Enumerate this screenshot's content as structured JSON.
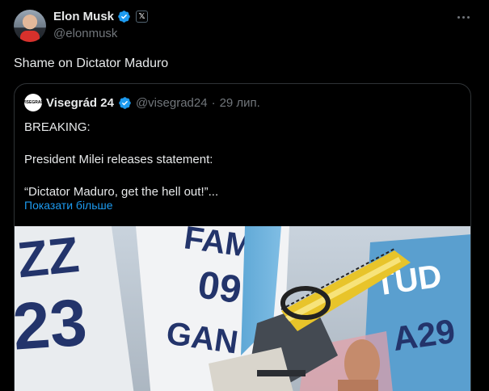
{
  "post": {
    "author_name": "Elon Musk",
    "author_handle": "@elonmusk",
    "x_badge": "𝕏",
    "text": "Shame on Dictator Maduro",
    "more_icon": "more-horizontal-icon"
  },
  "quote": {
    "avatar_text": "VISEGRAD",
    "name": "Visegrád 24",
    "handle": "@visegrad24",
    "separator": "·",
    "date": "29 лип.",
    "lines": [
      "BREAKING:",
      "President Milei releases statement:",
      "“Dictator Maduro, get the hell out!”..."
    ],
    "show_more": "Показати більше",
    "image_desc_icon": "photo-chainsaw"
  },
  "colors": {
    "background": "#000000",
    "text": "#e7e9ea",
    "secondary": "#71767b",
    "accent": "#1d9bf0",
    "border": "#2f3336"
  }
}
